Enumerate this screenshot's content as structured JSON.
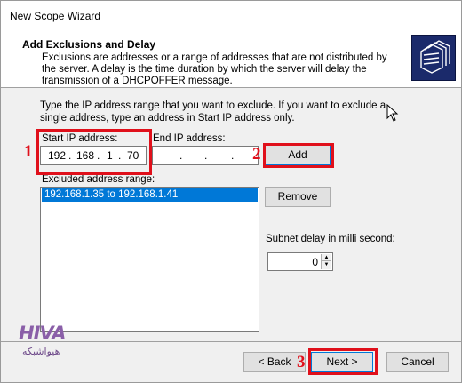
{
  "window": {
    "title": "New Scope Wizard"
  },
  "header": {
    "title": "Add Exclusions and Delay",
    "description": "Exclusions are addresses or a range of addresses that are not distributed by the server. A delay is the time duration by which the server will delay the transmission of a DHCPOFFER message."
  },
  "intro": "Type the IP address range that you want to exclude. If you want to exclude a single address, type an address in Start IP address only.",
  "start_ip": {
    "label": "Start IP address:",
    "octets": [
      "192",
      "168",
      "1",
      "70"
    ]
  },
  "end_ip": {
    "label": "End IP address:",
    "octets": [
      "",
      "",
      "",
      ""
    ]
  },
  "buttons": {
    "add": "Add",
    "remove": "Remove",
    "back": "< Back",
    "next": "Next >",
    "cancel": "Cancel"
  },
  "excluded": {
    "label": "Excluded address range:",
    "items": [
      "192.168.1.35 to 192.168.1.41"
    ]
  },
  "subnet_delay": {
    "label": "Subnet delay in milli second:",
    "value": "0"
  },
  "annotations": {
    "one": "1",
    "two": "2",
    "three": "3",
    "color": "#e0101b"
  },
  "logo": {
    "mark": "HIVA",
    "sub": "هیواشبکه"
  }
}
